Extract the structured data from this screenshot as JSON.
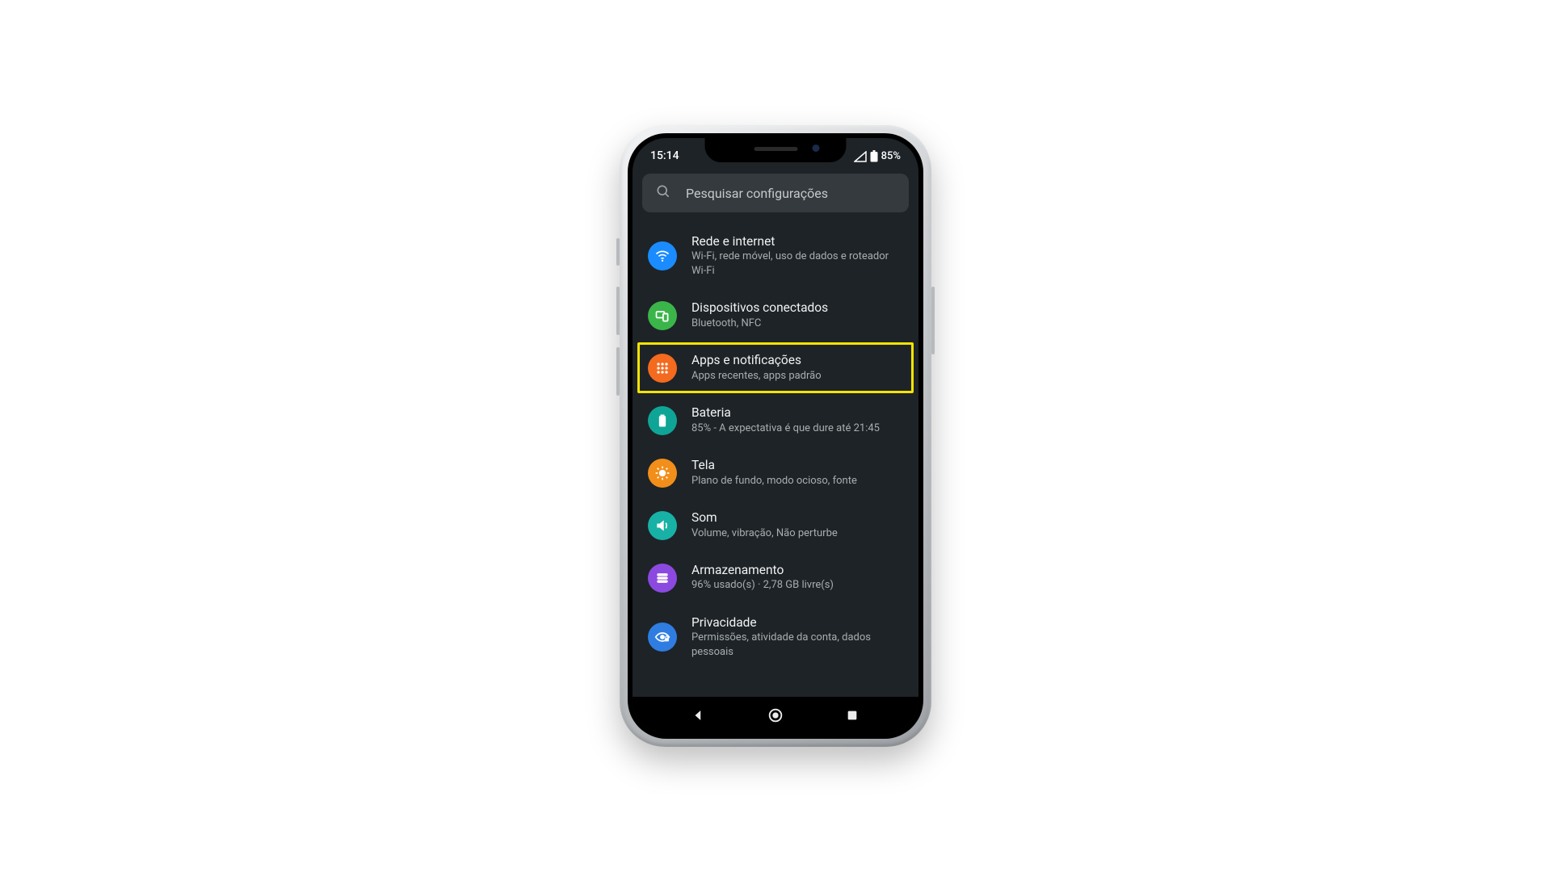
{
  "status": {
    "time": "15:14",
    "battery_pct": "85%"
  },
  "search": {
    "placeholder": "Pesquisar configurações"
  },
  "items": {
    "network": {
      "title": "Rede e internet",
      "sub": "Wi-Fi, rede móvel, uso de dados e roteador Wi-Fi"
    },
    "devices": {
      "title": "Dispositivos conectados",
      "sub": "Bluetooth, NFC"
    },
    "apps": {
      "title": "Apps e notificações",
      "sub": "Apps recentes, apps padrão"
    },
    "battery": {
      "title": "Bateria",
      "sub": "85% - A expectativa é que dure até 21:45"
    },
    "display": {
      "title": "Tela",
      "sub": "Plano de fundo, modo ocioso, fonte"
    },
    "sound": {
      "title": "Som",
      "sub": "Volume, vibração, Não perturbe"
    },
    "storage": {
      "title": "Armazenamento",
      "sub": "96% usado(s) · 2,78 GB livre(s)"
    },
    "privacy": {
      "title": "Privacidade",
      "sub": "Permissões, atividade da conta, dados pessoais"
    }
  },
  "highlight_key": "apps"
}
